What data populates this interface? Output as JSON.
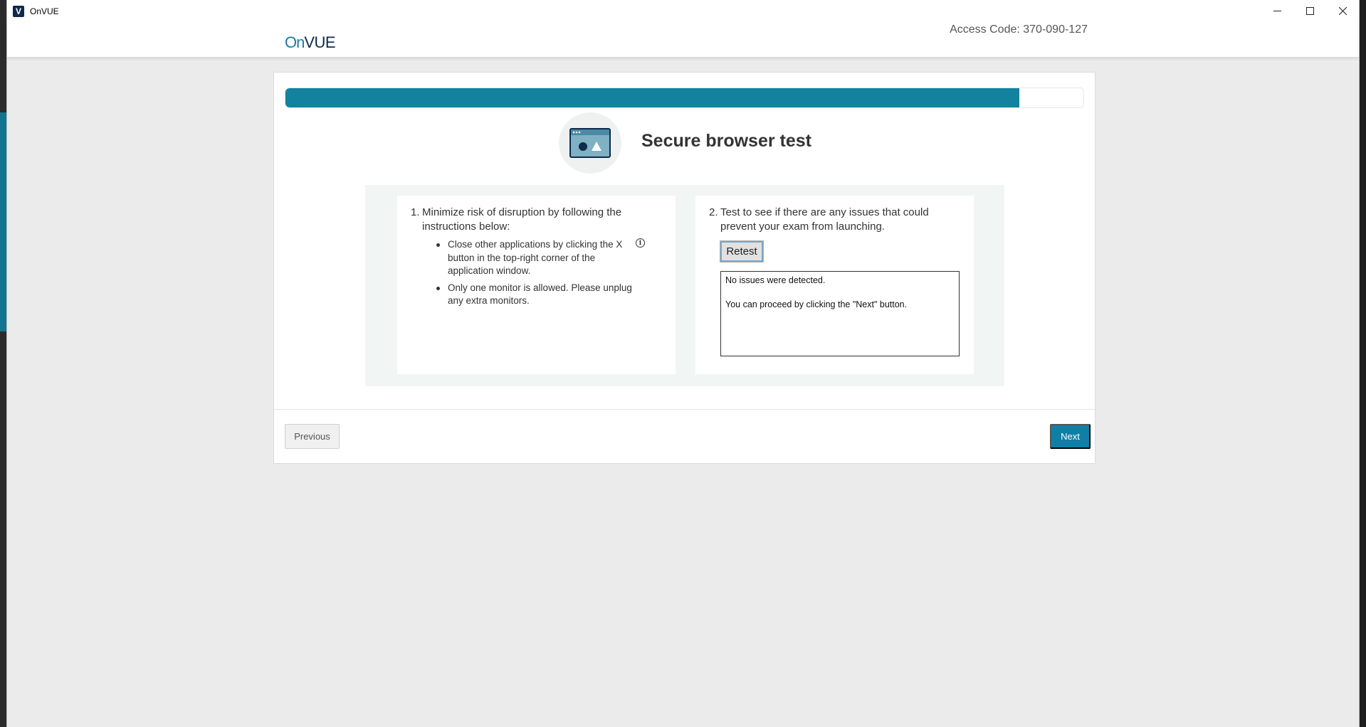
{
  "window": {
    "app_icon_letter": "V",
    "title": "OnVUE"
  },
  "header": {
    "logo_on": "On",
    "logo_vue": "VUE",
    "access_code": "Access Code: 370-090-127"
  },
  "progress": {
    "fraction": 0.92,
    "color": "#12829f"
  },
  "main": {
    "title": "Secure browser test",
    "icon": "browser-window-icon",
    "step1": {
      "number": "1.",
      "line1": "Minimize risk of disruption by following the",
      "line2": "instructions below:",
      "bullets": [
        [
          "Close other applications by clicking the X",
          "button in the top-right corner of the",
          "application window."
        ],
        [
          "Only one monitor is allowed. Please unplug",
          "any extra monitors."
        ]
      ],
      "info_icon": "info-icon"
    },
    "step2": {
      "number": "2.",
      "line1": "Test to see if there are any issues that could",
      "line2": "prevent your exam from launching.",
      "retest_label": "Retest",
      "result_line1": "No issues were detected.",
      "result_line2": "You can proceed by clicking the \"Next\" button."
    }
  },
  "footer": {
    "previous_label": "Previous",
    "next_label": "Next"
  },
  "colors": {
    "accent": "#0f7fa6",
    "navy": "#0e2a4d",
    "panel_bg": "#f1f6f4",
    "page_bg": "#ebebeb"
  }
}
